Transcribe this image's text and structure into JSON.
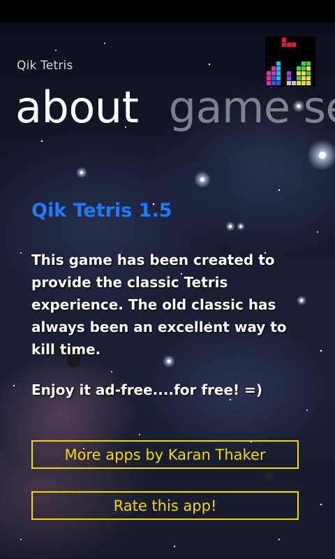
{
  "app": {
    "title": "Qik Tetris"
  },
  "pivot": {
    "items": [
      {
        "label": "about"
      },
      {
        "label": "game settings"
      }
    ]
  },
  "content": {
    "heading": "Qik Tetris 1.5",
    "description": "This game has been created to provide the classic Tetris experience. The old classic has always been an excellent way to kill time.",
    "tagline": "Enjoy it ad-free....for free! =)"
  },
  "buttons": {
    "more_apps": "More apps by Karan Thaker",
    "rate": "Rate this app!"
  },
  "colors": {
    "heading": "#1e7bff",
    "button_accent": "#f5d800",
    "text": "#ffffff",
    "status_bar": "#000000"
  },
  "icons": [
    "tetris-logo-icon"
  ]
}
